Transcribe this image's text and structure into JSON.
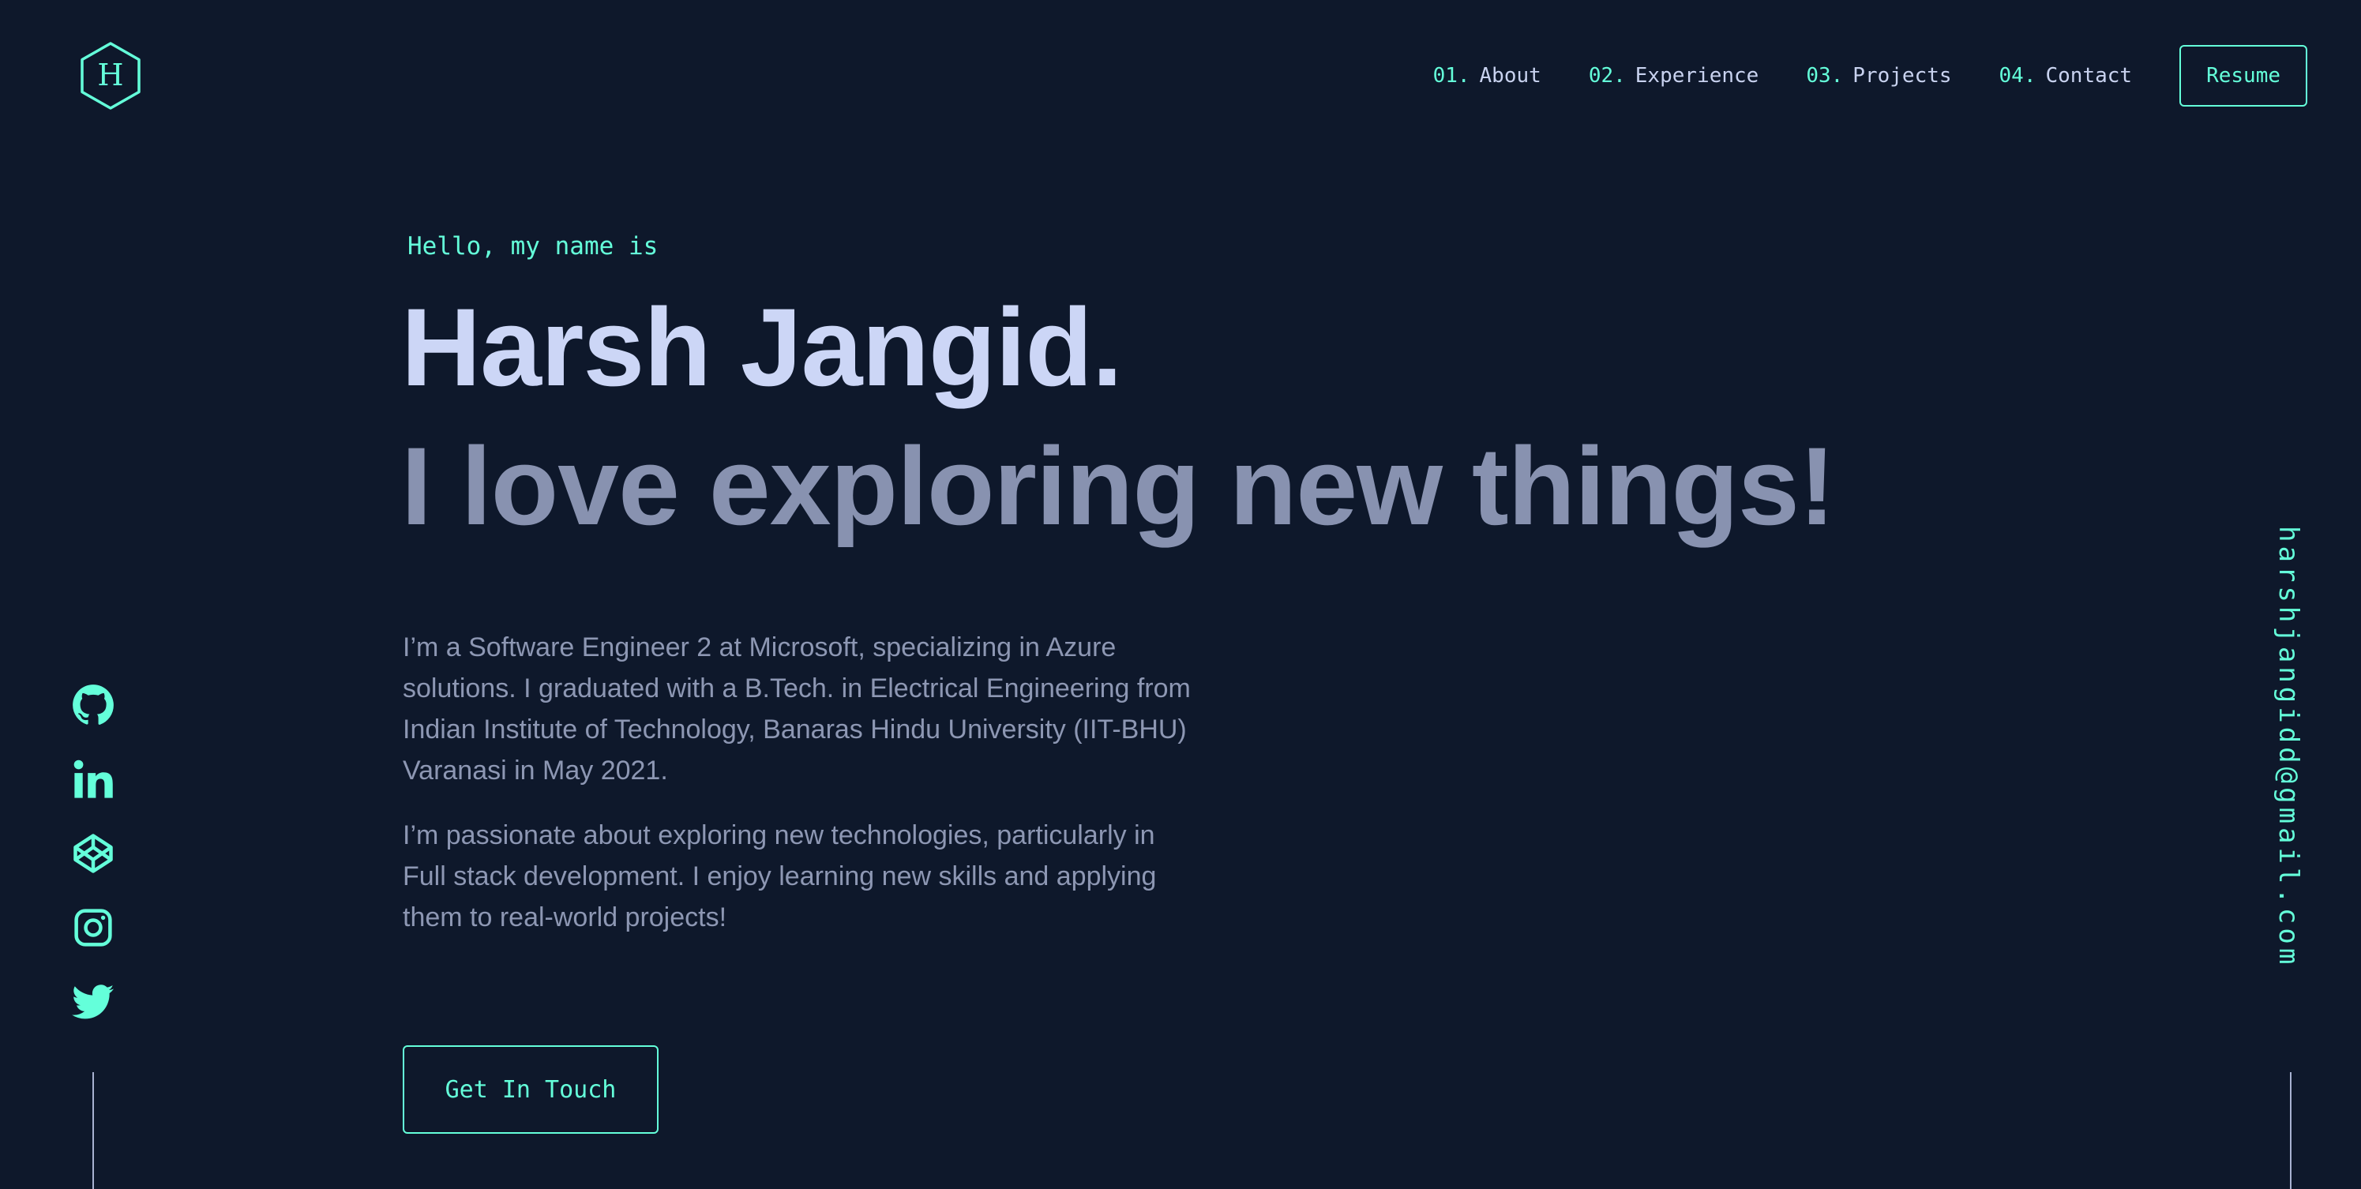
{
  "nav": {
    "items": [
      {
        "num": "01.",
        "label": "About"
      },
      {
        "num": "02.",
        "label": "Experience"
      },
      {
        "num": "03.",
        "label": "Projects"
      },
      {
        "num": "04.",
        "label": "Contact"
      }
    ],
    "resume_label": "Resume"
  },
  "logo": {
    "letter": "H",
    "icon": "hexagon-logo-icon"
  },
  "hero": {
    "greeting": "Hello, my name is",
    "name": "Harsh Jangid.",
    "tagline": "I love exploring new things!",
    "bio_1": "I’m a Software Engineer 2 at Microsoft, specializing in Azure solutions. I graduated with a B.Tech. in Electrical Engineering from Indian Institute of Technology, Banaras Hindu University (IIT-BHU) Varanasi in May 2021.",
    "bio_2": "I’m passionate about exploring new technologies, particularly in Full stack development. I enjoy learning new skills and applying them to real-world projects!",
    "cta_label": "Get In Touch"
  },
  "socials": [
    "github-icon",
    "linkedin-icon",
    "codepen-icon",
    "instagram-icon",
    "twitter-icon"
  ],
  "email": "harshjangidd@gmail.com",
  "colors": {
    "background": "#0e182b",
    "accent": "#64ffda",
    "heading": "#ccd6f6",
    "muted": "#8892b0"
  }
}
